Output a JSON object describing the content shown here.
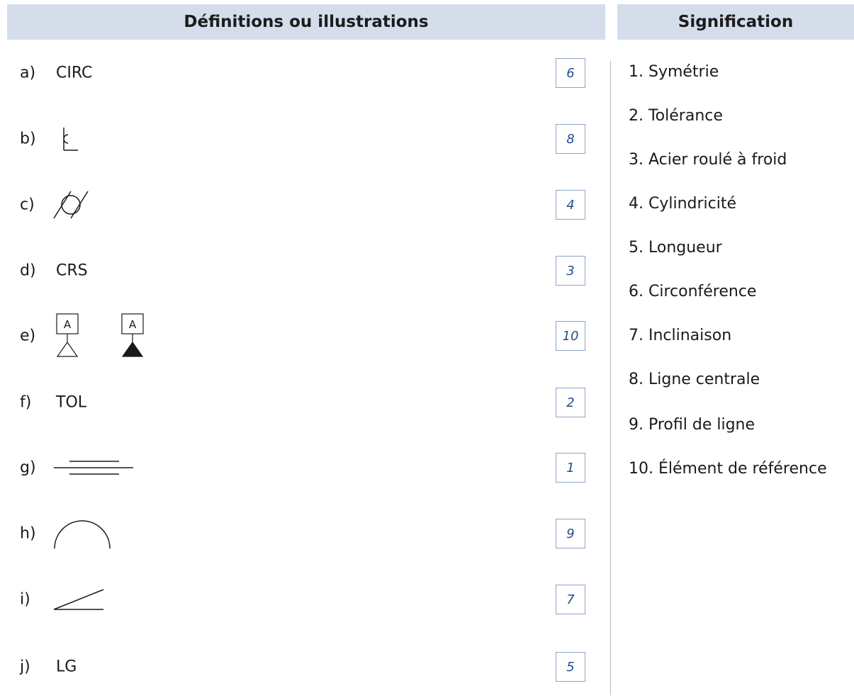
{
  "headers": {
    "left": "Définitions ou illustrations",
    "right": "Signification"
  },
  "definitions": [
    {
      "letter": "a)",
      "term": "CIRC",
      "symbol": "",
      "answer": "6"
    },
    {
      "letter": "b)",
      "term": "",
      "symbol": "centerline-symbol-icon",
      "answer": "8"
    },
    {
      "letter": "c)",
      "term": "",
      "symbol": "cylindricity-symbol-icon",
      "answer": "4"
    },
    {
      "letter": "d)",
      "term": "CRS",
      "symbol": "",
      "answer": "3"
    },
    {
      "letter": "e)",
      "term": "",
      "symbol": "datum-feature-symbol-icon",
      "symbol_text": "A",
      "answer": "10"
    },
    {
      "letter": "f)",
      "term": "TOL",
      "symbol": "",
      "answer": "2"
    },
    {
      "letter": "g)",
      "term": "",
      "symbol": "symmetry-symbol-icon",
      "answer": "1"
    },
    {
      "letter": "h)",
      "term": "",
      "symbol": "profile-of-line-symbol-icon",
      "answer": "9"
    },
    {
      "letter": "i)",
      "term": "",
      "symbol": "angularity-symbol-icon",
      "answer": "7"
    },
    {
      "letter": "j)",
      "term": "LG",
      "symbol": "",
      "answer": "5"
    }
  ],
  "meanings": [
    "1. Symétrie",
    "2. Tolérance",
    "3. Acier roulé à froid",
    "4. Cylindricité",
    "5. Longueur",
    "6. Circonférence",
    "7. Inclinaison",
    "8. Ligne centrale",
    "9. Profil de ligne",
    "10. Élément de référence"
  ],
  "colors": {
    "header_bg": "#d5ddeb",
    "answer_text": "#1f4e8c",
    "answer_border": "#8da4c4"
  }
}
